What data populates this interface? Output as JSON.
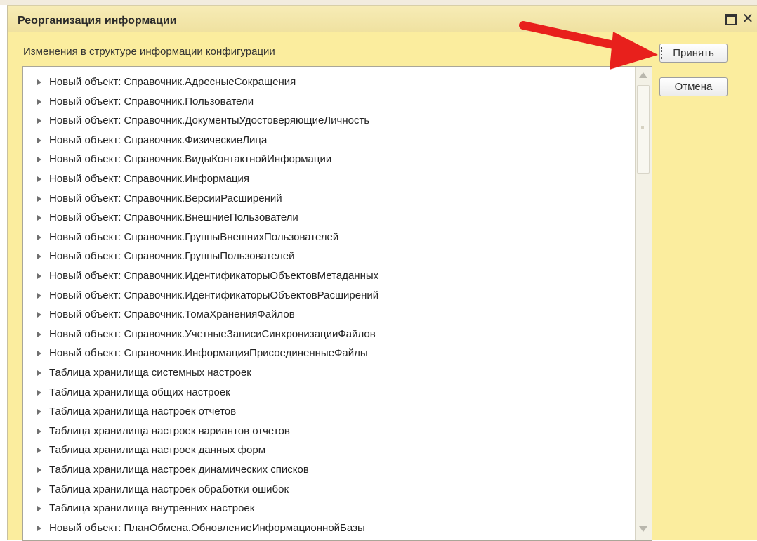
{
  "window": {
    "title": "Реорганизация информации"
  },
  "subheader": "Изменения в структуре информации конфигурации",
  "buttons": {
    "accept": "Принять",
    "cancel": "Отмена"
  },
  "items": [
    "Новый объект: Справочник.АдресныеСокращения",
    "Новый объект: Справочник.Пользователи",
    "Новый объект: Справочник.ДокументыУдостоверяющиеЛичность",
    "Новый объект: Справочник.ФизическиеЛица",
    "Новый объект: Справочник.ВидыКонтактнойИнформации",
    "Новый объект: Справочник.Информация",
    "Новый объект: Справочник.ВерсииРасширений",
    "Новый объект: Справочник.ВнешниеПользователи",
    "Новый объект: Справочник.ГруппыВнешнихПользователей",
    "Новый объект: Справочник.ГруппыПользователей",
    "Новый объект: Справочник.ИдентификаторыОбъектовМетаданных",
    "Новый объект: Справочник.ИдентификаторыОбъектовРасширений",
    "Новый объект: Справочник.ТомаХраненияФайлов",
    "Новый объект: Справочник.УчетныеЗаписиСинхронизацииФайлов",
    "Новый объект: Справочник.ИнформацияПрисоединенныеФайлы",
    "Таблица хранилища системных настроек",
    "Таблица хранилища общих настроек",
    "Таблица хранилища настроек отчетов",
    "Таблица хранилища настроек вариантов отчетов",
    "Таблица хранилища настроек данных форм",
    "Таблица хранилища настроек динамических списков",
    "Таблица хранилища настроек обработки ошибок",
    "Таблица хранилища внутренних настроек",
    "Новый объект: ПланОбмена.ОбновлениеИнформационнойБазы"
  ],
  "icons": {
    "expand": "expand-triangle-icon",
    "maximize": "maximize-icon",
    "close": "close-icon",
    "scroll_up": "scroll-up-arrow-icon",
    "scroll_down": "scroll-down-arrow-icon"
  },
  "colors": {
    "window_bg": "#fbed9e",
    "annotation_arrow": "#e8201c"
  }
}
